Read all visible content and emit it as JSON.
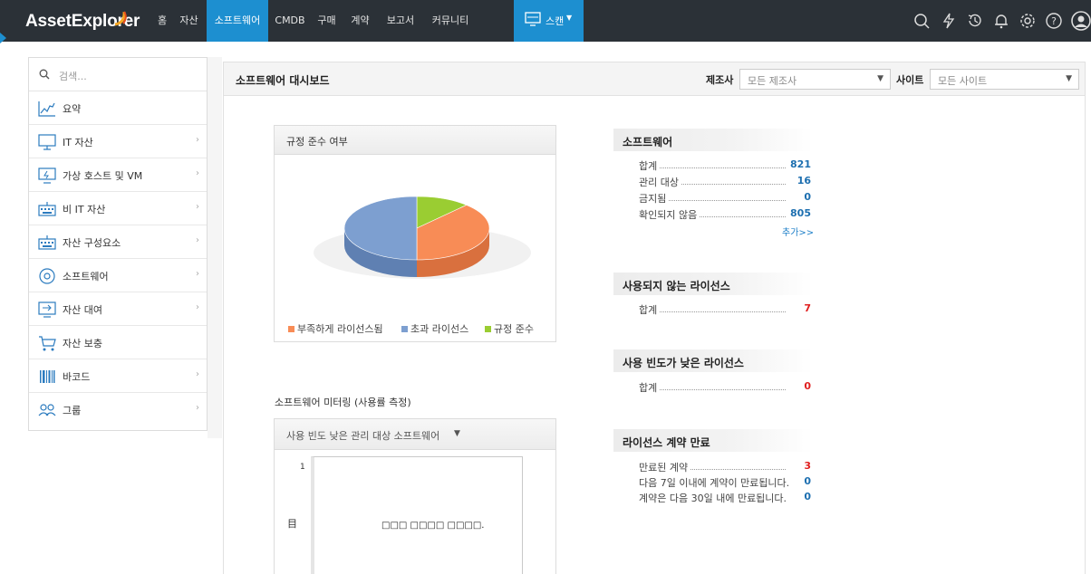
{
  "app": {
    "logo": "AssetExplorer",
    "nav": [
      "홈",
      "자산",
      "소프트웨어",
      "CMDB",
      "구매",
      "계약",
      "보고서",
      "커뮤니티"
    ],
    "active_nav": "소프트웨어",
    "scan_label": "스캔"
  },
  "sidebar": {
    "search_placeholder": "검색...",
    "items": [
      {
        "label": "요약",
        "icon": "summary-chart-icon",
        "has_arrow": false
      },
      {
        "label": "IT 자산",
        "icon": "monitor-icon",
        "has_arrow": true
      },
      {
        "label": "가상 호스트 및 VM",
        "icon": "virtual-host-icon",
        "has_arrow": true
      },
      {
        "label": "비 IT 자산",
        "icon": "keyboard-icon",
        "has_arrow": true
      },
      {
        "label": "자산 구성요소",
        "icon": "keyboard-component-icon",
        "has_arrow": true
      },
      {
        "label": "소프트웨어",
        "icon": "disc-icon",
        "has_arrow": true
      },
      {
        "label": "자산 대여",
        "icon": "asset-loan-icon",
        "has_arrow": true
      },
      {
        "label": "자산 보충",
        "icon": "cart-icon",
        "has_arrow": false
      },
      {
        "label": "바코드",
        "icon": "barcode-icon",
        "has_arrow": true
      },
      {
        "label": "그룹",
        "icon": "group-icon",
        "has_arrow": true
      }
    ]
  },
  "dashboard": {
    "title": "소프트웨어 대시보드",
    "manufacturer_label": "제조사",
    "manufacturer_value": "모든 제조사",
    "site_label": "사이트",
    "site_value": "모든 사이트"
  },
  "compliance": {
    "title": "규정 준수 여부",
    "colors": {
      "under": "#f88c56",
      "over": "#7d9fd0",
      "compliant": "#9acd32"
    },
    "legend": [
      "부족하게 라이선스됨",
      "초과 라이선스",
      "규정 준수"
    ]
  },
  "chart_data": {
    "type": "pie",
    "title": "규정 준수 여부",
    "labels": [
      "부족하게 라이선스됨",
      "초과 라이선스",
      "규정 준수"
    ],
    "values": [
      38,
      50,
      12
    ]
  },
  "metering": {
    "title": "소프트웨어 미터링 (사용률 측정)",
    "selector": "사용 빈도 낮은 관리 대상 소프트웨어",
    "y_tick": "1",
    "y_label": "目",
    "no_data": "□□□ □□□□ □□□□."
  },
  "software": {
    "title": "소프트웨어",
    "rows": [
      {
        "label": "합계",
        "value": "821"
      },
      {
        "label": "관리 대상",
        "value": "16"
      },
      {
        "label": "금지됨",
        "value": "0"
      },
      {
        "label": "확인되지 않음",
        "value": "805"
      }
    ],
    "more": "추가>>"
  },
  "unused": {
    "title": "사용되지 않는 라이선스",
    "rows": [
      {
        "label": "합계",
        "value": "7"
      }
    ]
  },
  "lowuse": {
    "title": "사용 빈도가 낮은 라이선스",
    "rows": [
      {
        "label": "합계",
        "value": "0"
      }
    ]
  },
  "expiry": {
    "title": "라이선스 계약 만료",
    "rows": [
      {
        "label": "만료된 계약",
        "value": "3"
      },
      {
        "label": "다음 7일 이내에 계약이 만료됩니다.",
        "value": "0"
      },
      {
        "label": "계약은 다음 30일 내에 만료됩니다.",
        "value": "0"
      }
    ]
  }
}
